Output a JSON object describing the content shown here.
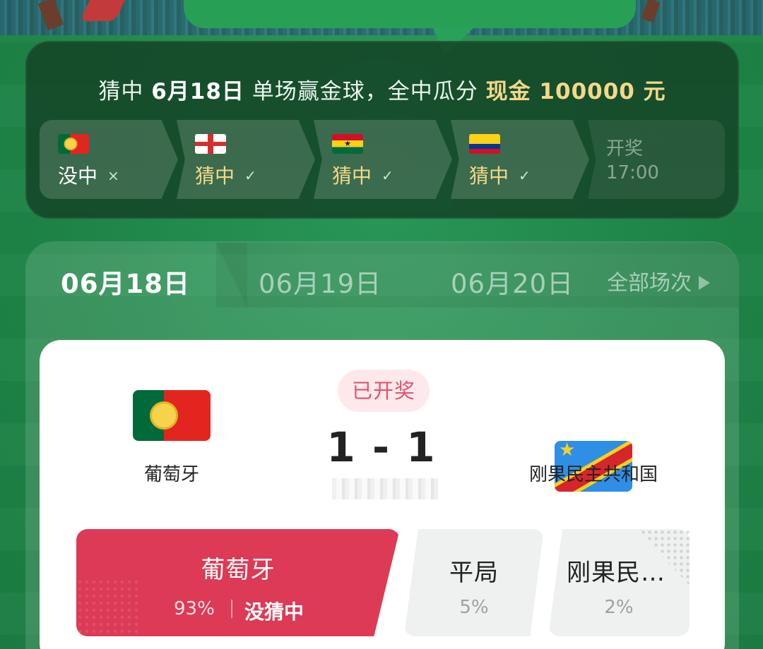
{
  "banner": {
    "title_prefix": "猜中",
    "title_date": "6月18日",
    "title_middle": "单场赢金球，全中瓜分",
    "title_prize": "现金 100000 元"
  },
  "steps": [
    {
      "flag": "portugal-flag",
      "label": "没中",
      "mark": "×",
      "hit": false
    },
    {
      "flag": "england-flag",
      "label": "猜中",
      "mark": "✓",
      "hit": true
    },
    {
      "flag": "ghana-flag",
      "label": "猜中",
      "mark": "✓",
      "hit": true
    },
    {
      "flag": "colombia-flag",
      "label": "猜中",
      "mark": "✓",
      "hit": true
    }
  ],
  "draw_step": {
    "label": "开奖",
    "time": "17:00"
  },
  "tabs": [
    {
      "label": "06月18日",
      "active": true
    },
    {
      "label": "06月19日",
      "active": false
    },
    {
      "label": "06月20日",
      "active": false
    }
  ],
  "tab_all": "全部场次",
  "match": {
    "status": "已开奖",
    "score": "1 - 1",
    "home_team": "葡萄牙",
    "away_team": "刚果民主共和国"
  },
  "options": {
    "home": {
      "title": "葡萄牙",
      "pct": "93%",
      "result": "没猜中"
    },
    "draw": {
      "title": "平局",
      "pct": "5%"
    },
    "away": {
      "title": "刚果民…",
      "pct": "2%"
    }
  },
  "colors": {
    "background_green": "#1f8a4c",
    "gold": "#f4d88a",
    "home_option_red": "#dc3a55",
    "status_pink": "#e2556d"
  }
}
